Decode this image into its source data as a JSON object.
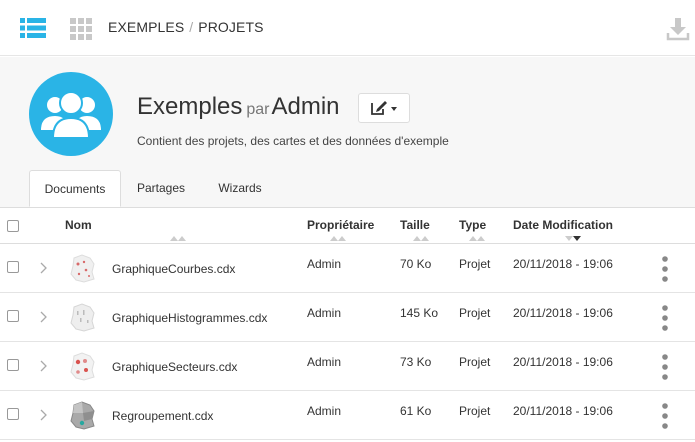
{
  "breadcrumb": {
    "root": "EXEMPLES",
    "separator": "/",
    "current": "PROJETS"
  },
  "icons": {
    "menu": "list-menu-icon",
    "grid": "grid-icon",
    "download": "download-icon",
    "avatar": "user-group-icon",
    "edit": "edit-icon",
    "row_expand": "chevron-right-icon",
    "row_actions": "vertical-dots-icon"
  },
  "colors": {
    "accent": "#2ab4e6",
    "muted_icon": "#c8c8c8"
  },
  "header": {
    "title": "Exemples",
    "by": "par",
    "owner": "Admin",
    "description": "Contient des projets, des cartes et des données d'exemple"
  },
  "tabs": [
    {
      "label": "Documents",
      "active": true
    },
    {
      "label": "Partages",
      "active": false
    },
    {
      "label": "Wizards",
      "active": false
    }
  ],
  "table": {
    "columns": [
      "Nom",
      "Propriétaire",
      "Taille",
      "Type",
      "Date Modification"
    ],
    "sorted_column": "Date Modification",
    "sort_direction": "descending",
    "rows": [
      {
        "name": "GraphiqueCourbes.cdx",
        "owner": "Admin",
        "size": "70 Ko",
        "type": "Projet",
        "date": "20/11/2018 - 19:06"
      },
      {
        "name": "GraphiqueHistogrammes.cdx",
        "owner": "Admin",
        "size": "145 Ko",
        "type": "Projet",
        "date": "20/11/2018 - 19:06"
      },
      {
        "name": "GraphiqueSecteurs.cdx",
        "owner": "Admin",
        "size": "73 Ko",
        "type": "Projet",
        "date": "20/11/2018 - 19:06"
      },
      {
        "name": "Regroupement.cdx",
        "owner": "Admin",
        "size": "61 Ko",
        "type": "Projet",
        "date": "20/11/2018 - 19:06"
      }
    ]
  }
}
